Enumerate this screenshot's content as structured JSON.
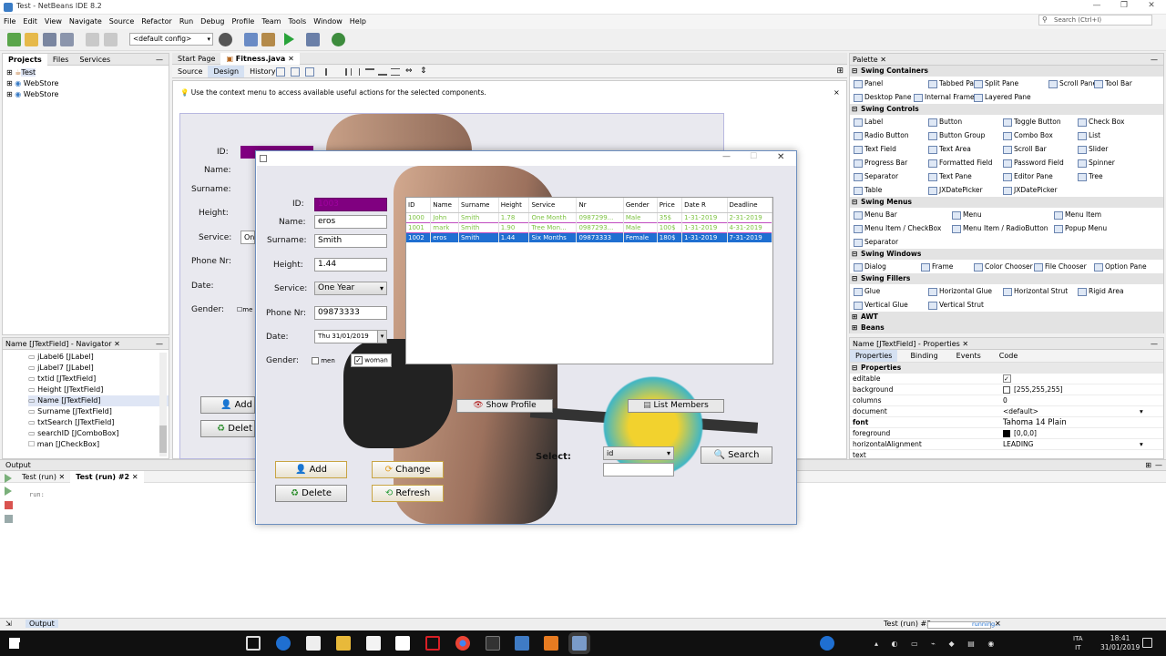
{
  "window": {
    "title": "Test - NetBeans IDE 8.2"
  },
  "search": {
    "placeholder": "Search (Ctrl+I)"
  },
  "menu": [
    "File",
    "Edit",
    "View",
    "Navigate",
    "Source",
    "Refactor",
    "Run",
    "Debug",
    "Profile",
    "Team",
    "Tools",
    "Window",
    "Help"
  ],
  "toolbar": {
    "config": "<default config>"
  },
  "projects": {
    "tabs": [
      "Projects",
      "Files",
      "Services"
    ],
    "items": [
      "Test",
      "WebStore",
      "WebStore"
    ]
  },
  "navigator": {
    "title": "Name [JTextField] - Navigator",
    "items": [
      "jLabel6 [JLabel]",
      "jLabel7 [JLabel]",
      "txtid [JTextField]",
      "Height [JTextField]",
      "Name [JTextField]",
      "Surname [JTextField]",
      "txtSearch [JTextField]",
      "searchID [JComboBox]",
      "man [JCheckBox]"
    ]
  },
  "editor": {
    "tabs": [
      "Start Page",
      "Fitness.java"
    ],
    "subtabs": [
      "Source",
      "Design",
      "History"
    ],
    "hint": "Use the context menu to access available useful actions for the selected components.",
    "form_labels": [
      "ID:",
      "Name:",
      "Surname:",
      "Height:",
      "Service:",
      "Phone Nr:",
      "Date:",
      "Gender:"
    ],
    "service_value": "One",
    "gender_value": "me",
    "add": "Add",
    "delete": "Delet"
  },
  "palette": {
    "title": "Palette",
    "categories": [
      {
        "name": "Swing Containers",
        "items": [
          "Panel",
          "Tabbed Pane",
          "Split Pane",
          "Scroll Pane",
          "Tool Bar",
          "Desktop Pane",
          "Internal Frame",
          "Layered Pane"
        ]
      },
      {
        "name": "Swing Controls",
        "items": [
          "Label",
          "Button",
          "Toggle Button",
          "Check Box",
          "Radio Button",
          "Button Group",
          "Combo Box",
          "List",
          "Text Field",
          "Text Area",
          "Scroll Bar",
          "Slider",
          "Progress Bar",
          "Formatted Field",
          "Password Field",
          "Spinner",
          "Separator",
          "Text Pane",
          "Editor Pane",
          "Tree",
          "Table",
          "JXDatePicker",
          "JXDatePicker"
        ]
      },
      {
        "name": "Swing Menus",
        "items": [
          "Menu Bar",
          "Menu",
          "Menu Item",
          "Menu Item / CheckBox",
          "Menu Item / RadioButton",
          "Popup Menu",
          "Separator"
        ]
      },
      {
        "name": "Swing Windows",
        "items": [
          "Dialog",
          "Frame",
          "Color Chooser",
          "File Chooser",
          "Option Pane"
        ]
      },
      {
        "name": "Swing Fillers",
        "items": [
          "Glue",
          "Horizontal Glue",
          "Horizontal Strut",
          "Rigid Area",
          "Vertical Glue",
          "Vertical Strut"
        ]
      },
      {
        "name": "AWT",
        "items": []
      },
      {
        "name": "Beans",
        "items": []
      }
    ]
  },
  "properties": {
    "title": "Name [JTextField] - Properties",
    "tabs": [
      "Properties",
      "Binding",
      "Events",
      "Code"
    ],
    "section": "Properties",
    "rows": [
      {
        "k": "editable",
        "v": "✓"
      },
      {
        "k": "background",
        "v": "[255,255,255]"
      },
      {
        "k": "columns",
        "v": "0"
      },
      {
        "k": "document",
        "v": "<default>"
      },
      {
        "k": "font",
        "v": "Tahoma 14 Plain"
      },
      {
        "k": "foreground",
        "v": "[0,0,0]"
      },
      {
        "k": "horizontalAlignment",
        "v": "LEADING"
      },
      {
        "k": "text",
        "v": ""
      }
    ]
  },
  "output": {
    "title": "Output",
    "tabs": [
      "Test (run)",
      "Test (run) #2"
    ],
    "text": "run:"
  },
  "status": {
    "left_tab": "Output",
    "run": "Test (run) #2",
    "running": "running..."
  },
  "taskbar": {
    "time": "18:41",
    "date": "31/01/2019",
    "lang": "ITA",
    "region": "IT"
  },
  "app": {
    "labels": {
      "id": "ID:",
      "name": "Name:",
      "surname": "Surname:",
      "height": "Height:",
      "service": "Service:",
      "phone": "Phone Nr:",
      "date": "Date:",
      "gender": "Gender:",
      "select": "Select:"
    },
    "values": {
      "id": "1003",
      "name": "eros",
      "surname": "Smith",
      "height": "1.44",
      "service": "One Year",
      "phone": "09873333",
      "date": "Thu 31/01/2019",
      "search_by": "id"
    },
    "gender": {
      "men": "men",
      "woman": "woman",
      "woman_checked": true
    },
    "buttons": {
      "add": "Add",
      "change": "Change",
      "delete": "Delete",
      "refresh": "Refresh",
      "search": "Search",
      "show_profile": "Show  Profile",
      "list_members": "List Members"
    },
    "table": {
      "columns": [
        "ID",
        "Name",
        "Surname",
        "Height",
        "Service",
        "Nr",
        "Gender",
        "Price",
        "Date R",
        "Deadline"
      ],
      "rows": [
        [
          "1000",
          "John",
          "Smith",
          "1.78",
          "One Month",
          "0987299...",
          "Male",
          "35$",
          "1-31-2019",
          "2-31-2019"
        ],
        [
          "1001",
          "mark",
          "Smith",
          "1.90",
          "Tree Mon...",
          "0987293...",
          "Male",
          "100$",
          "1-31-2019",
          "4-31-2019"
        ],
        [
          "1002",
          "eros",
          "Smith",
          "1.44",
          "Six Months",
          "09873333",
          "Female",
          "180$",
          "1-31-2019",
          "7-31-2019"
        ]
      ],
      "selected_row": 2
    }
  },
  "colors": {
    "accent": "#1f6fd1",
    "purple": "#800080",
    "row_green": "#7dc242"
  }
}
